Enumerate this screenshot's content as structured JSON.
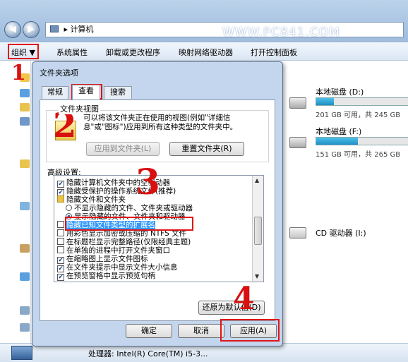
{
  "window": {
    "address_path": "计算机",
    "watermark": "WWW.PC841.COM"
  },
  "toolbar": {
    "organize": "组织 ▼",
    "system_properties": "系统属性",
    "uninstall": "卸载或更改程序",
    "map_drive": "映射网络驱动器",
    "control_panel": "打开控制面板"
  },
  "drives": [
    {
      "name": "本地磁盘 (D:)",
      "size": "201 GB 可用，共 245 GB",
      "used_fraction": 0.18
    },
    {
      "name": "本地磁盘 (F:)",
      "size": "151 GB 可用，共 265 GB",
      "used_fraction": 0.43
    },
    {
      "name": "CD 驱动器 (I:)",
      "size": ""
    }
  ],
  "status": {
    "processor": "处理器: Intel(R) Core(TM) i5-3..."
  },
  "dialog": {
    "title": "文件夹选项",
    "tabs": [
      "常规",
      "查看",
      "搜索"
    ],
    "folder_view": {
      "label": "文件夹视图",
      "description": "可以将该文件夹正在使用的视图(例如\"详细信息\"或\"图标\")应用到所有这种类型的文件夹中。",
      "apply_button": "应用到文件夹(L)",
      "reset_button": "重置文件夹(R)"
    },
    "advanced_label": "高级设置:",
    "settings": [
      {
        "type": "checkbox",
        "checked": true,
        "indent": 0,
        "label": "隐藏计算机文件夹中的空驱动器"
      },
      {
        "type": "checkbox",
        "checked": true,
        "indent": 0,
        "label": "隐藏受保护的操作系统文件(推荐)"
      },
      {
        "type": "folder",
        "indent": 0,
        "label": "隐藏文件和文件夹"
      },
      {
        "type": "radio",
        "checked": false,
        "indent": 1,
        "label": "不显示隐藏的文件、文件夹或驱动器"
      },
      {
        "type": "radio",
        "checked": true,
        "indent": 1,
        "label": "显示隐藏的文件、文件夹和驱动器"
      },
      {
        "type": "checkbox",
        "checked": false,
        "indent": 0,
        "label": "隐藏已知文件类型的扩展名",
        "selected": true
      },
      {
        "type": "checkbox",
        "checked": false,
        "indent": 0,
        "label": "用彩色显示加密或压缩的 NTFS 文件"
      },
      {
        "type": "checkbox",
        "checked": false,
        "indent": 0,
        "label": "在标题栏显示完整路径(仅限经典主题)"
      },
      {
        "type": "checkbox",
        "checked": false,
        "indent": 0,
        "label": "在单独的进程中打开文件夹窗口"
      },
      {
        "type": "checkbox",
        "checked": true,
        "indent": 0,
        "label": "在缩略图上显示文件图标"
      },
      {
        "type": "checkbox",
        "checked": true,
        "indent": 0,
        "label": "在文件夹提示中显示文件大小信息"
      },
      {
        "type": "checkbox",
        "checked": true,
        "indent": 0,
        "label": "在预览窗格中显示预览句柄"
      }
    ],
    "restore_button": "还原为默认值(D)",
    "ok_button": "确定",
    "cancel_button": "取消",
    "apply_button": "应用(A)"
  },
  "annotations": [
    "1",
    "2",
    "3",
    "4"
  ],
  "colors": {
    "annotation": "#e01515",
    "selection": "#3399ff"
  }
}
